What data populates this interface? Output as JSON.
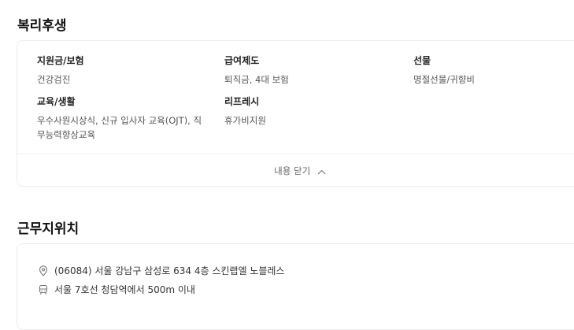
{
  "benefits": {
    "title": "복리후생",
    "items": [
      {
        "heading": "지원금/보험",
        "value": "건강검진"
      },
      {
        "heading": "급여제도",
        "value": "퇴직금, 4대 보험"
      },
      {
        "heading": "선물",
        "value": "명절선물/귀향비"
      },
      {
        "heading": "교육/생활",
        "value_line1": "우수사원시상식, 신규 입사자 교육(OJT), 직",
        "value_line2": "무능력향상교육"
      },
      {
        "heading": "리프레시",
        "value": "휴가비지원"
      }
    ],
    "toggle_label": "내용 닫기"
  },
  "location": {
    "title": "근무지위치",
    "address": "(06084) 서울 강남구 삼성로 634 4층 스킨랩엘 노블레스",
    "subway": "서울 7호선 청담역에서 500m 이내",
    "address_icon": "location-pin-icon",
    "subway_icon": "subway-train-icon"
  }
}
